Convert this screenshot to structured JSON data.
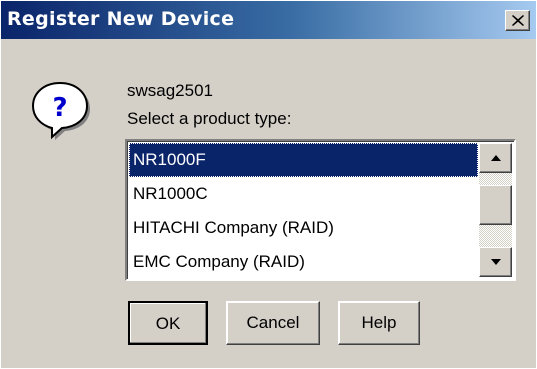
{
  "window": {
    "title": "Register New Device",
    "close_glyph": "X"
  },
  "dialog": {
    "icon": "question-icon",
    "device_name": "swsag2501",
    "prompt": "Select a product type:"
  },
  "product_list": {
    "items": [
      "NR1000F",
      "NR1000C",
      "HITACHI Company (RAID)",
      "EMC Company (RAID)"
    ],
    "selected": "NR1000F"
  },
  "buttons": {
    "ok": "OK",
    "cancel": "Cancel",
    "help": "Help"
  },
  "colors": {
    "title_start": "#0a246a",
    "title_end": "#a6caf0",
    "dialog_face": "#d4d0c8",
    "selection": "#0a246a"
  }
}
